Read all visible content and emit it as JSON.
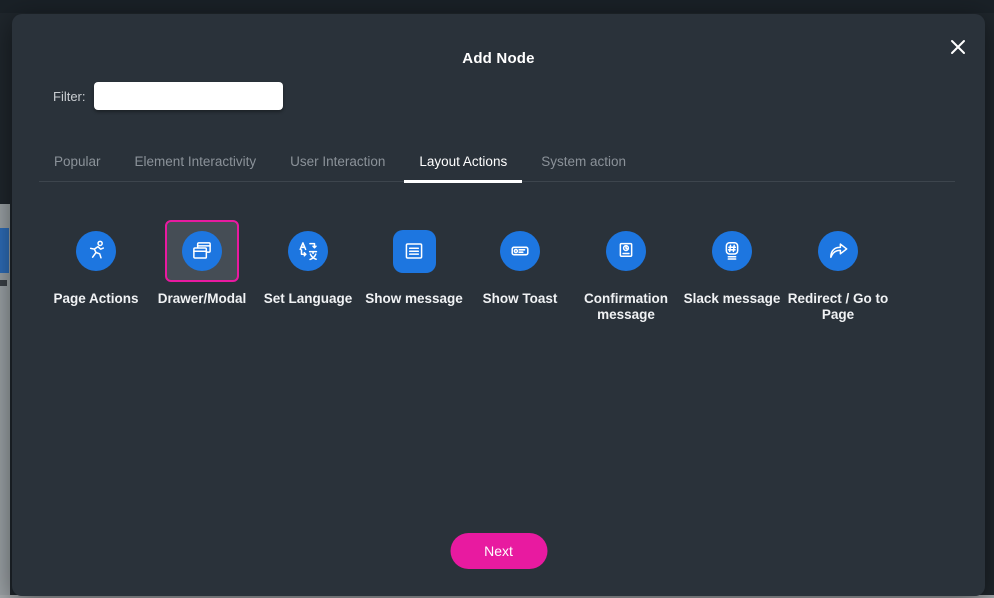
{
  "modal": {
    "title": "Add Node"
  },
  "filter": {
    "label": "Filter:",
    "value": ""
  },
  "tabs": [
    {
      "label": "Popular",
      "active": false
    },
    {
      "label": "Element Interactivity",
      "active": false
    },
    {
      "label": "User Interaction",
      "active": false
    },
    {
      "label": "Layout Actions",
      "active": true
    },
    {
      "label": "System action",
      "active": false
    }
  ],
  "actions": [
    {
      "label": "Page Actions",
      "icon": "runner-icon",
      "selected": false
    },
    {
      "label": "Drawer/Modal",
      "icon": "window-stack-icon",
      "selected": true
    },
    {
      "label": "Set Language",
      "icon": "translate-icon",
      "selected": false
    },
    {
      "label": "Show message",
      "icon": "message-lines-icon",
      "selected": false
    },
    {
      "label": "Show Toast",
      "icon": "toast-icon",
      "selected": false
    },
    {
      "label": "Confirmation message",
      "icon": "confirmation-doc-icon",
      "selected": false
    },
    {
      "label": "Slack message",
      "icon": "slack-hash-icon",
      "selected": false
    },
    {
      "label": "Redirect / Go to Page",
      "icon": "redirect-arrow-icon",
      "selected": false
    }
  ],
  "footer": {
    "next_label": "Next"
  },
  "colors": {
    "accent_blue": "#1d76e0",
    "accent_pink": "#e81aa0",
    "modal_bg": "#2a323a",
    "tab_inactive": "#8b9299",
    "tab_active": "#ffffff"
  }
}
